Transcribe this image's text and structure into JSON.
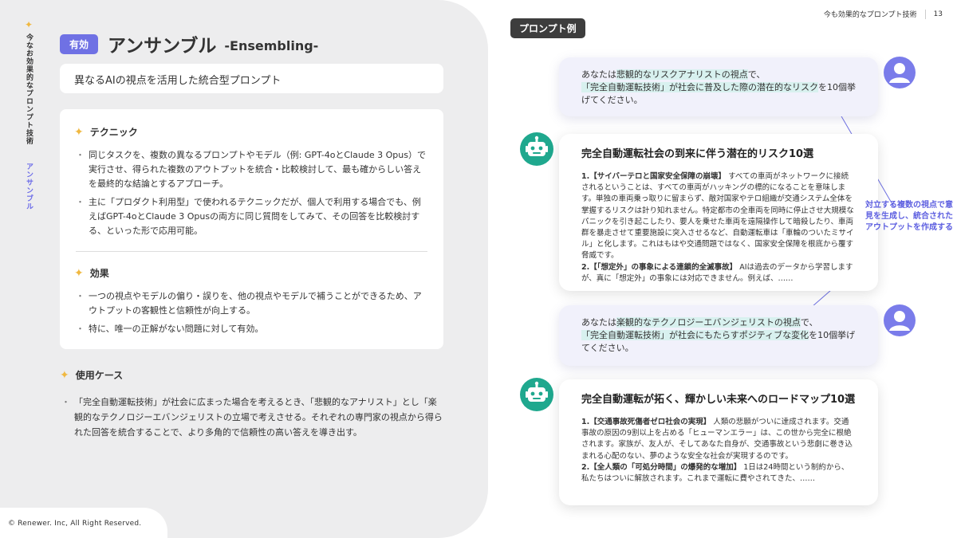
{
  "side": {
    "vertical_title": "今なお効果的なプロンプト技術",
    "vertical_sub": "アンサンブル"
  },
  "header": {
    "badge": "有効",
    "title": "アンサンブル",
    "title_en": "-Ensembling-",
    "subtitle": "異なるAIの視点を活用した統合型プロンプト",
    "section_right": "今も効果的なプロンプト技術",
    "page_number": "13"
  },
  "technique": {
    "heading": "テクニック",
    "bullets": [
      "同じタスクを、複数の異なるプロンプトやモデル（例: GPT-4oとClaude 3 Opus）で実行させ、得られた複数のアウトプットを統合・比較検討して、最も確からしい答えを最終的な結論とするアプローチ。",
      "主に「プロダクト利用型」で使われるテクニックだが、個人で利用する場合でも、例えばGPT-4oとClaude 3 Opusの両方に同じ質問をしてみて、その回答を比較検討する、といった形で応用可能。"
    ]
  },
  "effect": {
    "heading": "効果",
    "bullets": [
      "一つの視点やモデルの偏り・誤りを、他の視点やモデルで補うことができるため、アウトプットの客観性と信頼性が向上する。",
      "特に、唯一の正解がない問題に対して有効。"
    ]
  },
  "usecase": {
    "heading": "使用ケース",
    "bullets": [
      "「完全自動運転技術」が社会に広まった場合を考えるとき、「悲観的なアナリスト」とし「楽観的なテクノロジーエバンジェリストの立場で考えさせる。それぞれの専門家の視点から得られた回答を統合することで、より多角的で信頼性の高い答えを導き出す。"
    ]
  },
  "prompt_example": {
    "tag": "プロンプト例",
    "user1": {
      "a": "あなたは",
      "b": "悲観的なリスクアナリストの視点",
      "c": "で、",
      "d": "「完全自動運転技術」が社会に普及した際の潜在的なリスク",
      "e": "を10個挙げてください。"
    },
    "bot1": {
      "title": "完全自動運転社会の到来に伴う潜在的リスク10選",
      "h1": "1.【サイバーテロと国家安全保障の崩壊】",
      "t1": "すべての車両がネットワークに接続されるということは、すべての車両がハッキングの標的になることを意味します。単独の車両乗っ取りに留まらず、敵対国家やテロ組織が交通システム全体を掌握するリスクは計り知れません。特定都市の全車両を同時に停止させ大規模なパニックを引き起こしたり、要人を乗せた車両を遠隔操作して暗殺したり、車両群を暴走させて重要施設に突入させるなど、自動運転車は「車輪のついたミサイル」と化します。これはもはや交通問題ではなく、国家安全保障を根底から覆す脅威です。",
      "h2": "2.【「想定外」の事象による連鎖的全滅事故】",
      "t2": "AIは過去のデータから学習しますが、真に「想定外」の事象には対応できません。例えば、……"
    },
    "user2": {
      "a": "あなたは",
      "b": "楽観的なテクノロジーエバンジェリストの視点",
      "c": "で、",
      "d": "「完全自動運転技術」が社会にもたらすポジティブな変化",
      "e": "を10個挙げてください。"
    },
    "bot2": {
      "title": "完全自動運転が拓く、輝かしい未来へのロードマップ10選",
      "h1": "1.【交通事故死傷者ゼロ社会の実現】",
      "t1": "人類の悲願がついに達成されます。交通事故の原因の9割以上を占める「ヒューマンエラー」は、この世から完全に根絶されます。家族が、友人が、そしてあなた自身が、交通事故という悲劇に巻き込まれる心配のない、夢のような安全な社会が実現するのです。",
      "h2": "2.【全人類の「可処分時間」の爆発的な増加】",
      "t2": "1日は24時間という制約から、私たちはついに解放されます。これまで運転に費やされてきた、……"
    },
    "note": "対立する複数の視点で意見を生成し、統合されたアウトプットを作成する"
  },
  "footer": {
    "copyright": "© Renewer. Inc, All Right Reserved."
  },
  "colors": {
    "accent": "#6f71e4",
    "bot": "#1fa88e",
    "highlight": "#d8f1ef",
    "spark": "#f0b840"
  }
}
